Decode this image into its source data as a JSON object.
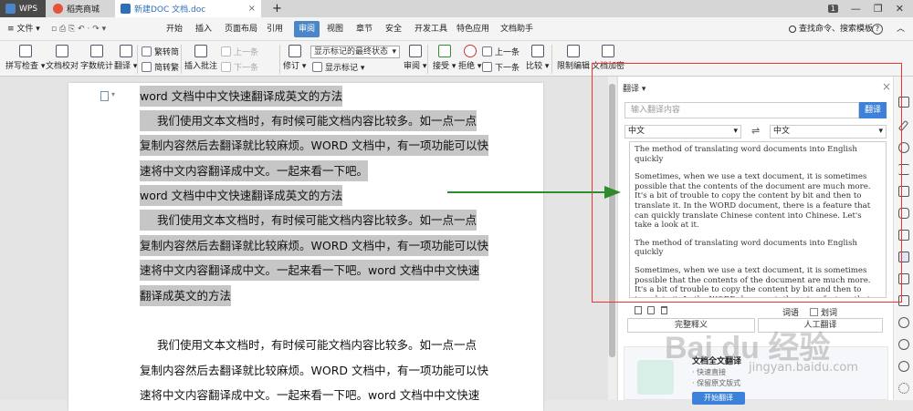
{
  "tabs": {
    "wps": "WPS",
    "store": "稻壳商城",
    "doc": "新建DOC 文档.doc",
    "add": "+"
  },
  "window": {
    "badge": "1",
    "min": "—",
    "max": "❐",
    "close": "✕"
  },
  "menu": {
    "file": "≡ 文件 ▾",
    "quick": "▫ ⎙ ⎘ ↶ · ↷ ▾",
    "items": [
      "开始",
      "插入",
      "页面布局",
      "引用",
      "审阅",
      "视图",
      "章节",
      "安全",
      "开发工具",
      "特色应用",
      "文档助手"
    ],
    "active_index": 4,
    "search": "查找命令、搜索模板",
    "help": "?",
    "more": "︿"
  },
  "ribbon": {
    "spell": "拼写检查 ▾",
    "proof": "文档校对",
    "count": "字数统计",
    "translate": "翻译 ▾",
    "t2s": "繁转简",
    "s2t": "简转繁",
    "insert_comment": "插入批注",
    "prev1": "上一条",
    "next1": "下一条",
    "revise": "修订 ▾",
    "show_select": "显示标记的最终状态",
    "show_marks": "显示标记 ▾",
    "review": "审阅 ▾",
    "accept": "接受 ▾",
    "reject": "拒绝 ▾",
    "prev2": "上一条",
    "next2": "下一条",
    "compare": "比较 ▾",
    "restrict": "限制编辑",
    "encrypt": "文档加密"
  },
  "doc": {
    "line1": "word 文档中中文快速翻译成英文的方法",
    "line2": "我们使用文本文档时，有时候可能文档内容比较多。如一点一点",
    "line3": "复制内容然后去翻译就比较麻烦。WORD 文档中，有一项功能可以快",
    "line4": "速将中文内容翻译成中文。一起来看一下吧。",
    "line5": "word 文档中中文快速翻译成英文的方法",
    "line6": "我们使用文本文档时，有时候可能文档内容比较多。如一点一点",
    "line7": "复制内容然后去翻译就比较麻烦。WORD 文档中，有一项功能可以快",
    "line8": "速将中文内容翻译成中文。一起来看一下吧。word 文档中中文快速",
    "line9": "翻译成英文的方法",
    "line10": "我们使用文本文档时，有时候可能文档内容比较多。如一点一点",
    "line11": "复制内容然后去翻译就比较麻烦。WORD 文档中，有一项功能可以快",
    "line12": "速将中文内容翻译成中文。一起来看一下吧。word 文档中中文快速"
  },
  "panel": {
    "title": "翻译 ▾",
    "close": "×",
    "input_placeholder": "输入翻译内容",
    "translate_btn": "翻译",
    "from_lang": "中文",
    "to_lang": "中文",
    "swap": "⇌",
    "out_p1": "The method of translating word documents into English quickly",
    "out_p2": "Sometimes, when we use a text document, it is sometimes possible that the contents of the document are much more. It's a bit of trouble to copy the content by bit and then to translate it. In the WORD document, there is a feature that can quickly translate Chinese content into Chinese. Let's take a look at it.",
    "out_p3": "The method of translating word documents into English quickly",
    "out_p4": "Sometimes, when we use a text document, it is sometimes possible that the contents of the document are much more. It's a bit of trouble to copy the content by bit and then to translate it. In the WORD document, there is a feature that can quickly translate Chinese content into Chinese. Let's take a look at it. Method for quickly translating Chinese into English in word document",
    "opt1": "词语",
    "opt2": "划词",
    "btn_complete": "完整释义",
    "btn_human": "人工翻译",
    "promo_title": "文档全文翻译",
    "promo_b1": "· 快速直接",
    "promo_b2": "· 保留原文版式",
    "promo_btn": "开始翻译"
  },
  "watermark": {
    "logo": "Bai du 经验",
    "url": "jingyan.baidu.com"
  },
  "colors": {
    "accent": "#3d82d8",
    "highlight": "#c6c6c6",
    "annotation_red": "#e33333",
    "arrow_green": "#2e8b2e"
  }
}
